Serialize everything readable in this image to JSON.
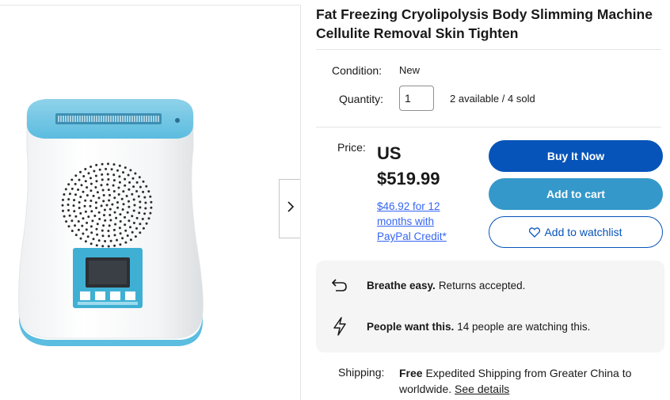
{
  "product": {
    "title": "Fat Freezing Cryolipolysis Body Slimming Machine Cellulite Removal Skin Tighten"
  },
  "condition": {
    "label": "Condition:",
    "value": "New"
  },
  "quantity": {
    "label": "Quantity:",
    "value": "1",
    "availability": "2 available / 4 sold"
  },
  "price": {
    "label": "Price:",
    "amount": "US $519.99",
    "financing": "$46.92 for 12 months with PayPal Credit*"
  },
  "buttons": {
    "buy_now": "Buy It Now",
    "add_to_cart": "Add to cart",
    "add_to_watchlist": "Add to watchlist"
  },
  "highlights": {
    "returns_bold": "Breathe easy.",
    "returns_text": "Returns accepted.",
    "watchers_bold": "People want this.",
    "watchers_text": "14 people are watching this."
  },
  "shipping": {
    "label": "Shipping:",
    "free": "Free",
    "text": "Expedited Shipping from Greater China to worldwide.",
    "link": "See details"
  },
  "icons": {
    "next": "chevron-right-icon",
    "watch": "heart-icon",
    "returns": "return-arrow-icon",
    "watchers": "lightning-icon"
  },
  "colors": {
    "primary": "#0654ba",
    "secondary": "#3498ca",
    "link": "#3665f3",
    "panel": "#f5f5f5"
  }
}
